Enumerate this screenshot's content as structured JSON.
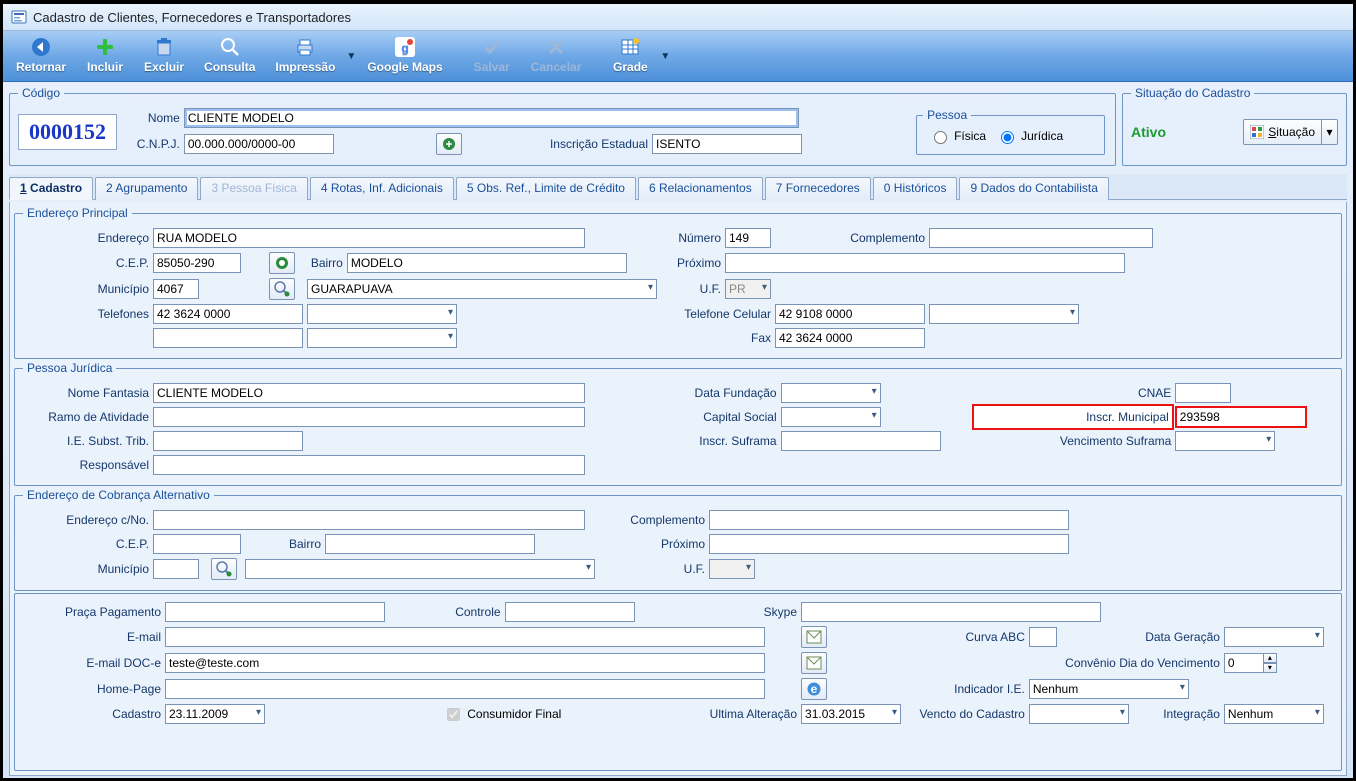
{
  "window": {
    "title": "Cadastro de Clientes, Fornecedores e Transportadores"
  },
  "toolbar": {
    "retornar": "Retornar",
    "incluir": "Incluir",
    "excluir": "Excluir",
    "consulta": "Consulta",
    "impressao": "Impressão",
    "googlemaps": "Google Maps",
    "salvar": "Salvar",
    "cancelar": "Cancelar",
    "grade": "Grade"
  },
  "header": {
    "codigo_legend": "Código",
    "codigo": "0000152",
    "nome_label": "Nome",
    "nome": "CLIENTE MODELO",
    "cnpj_label": "C.N.P.J.",
    "cnpj": "00.000.000/0000-00",
    "ie_label": "Inscrição Estadual",
    "ie": "ISENTO",
    "pessoa_legend": "Pessoa",
    "pessoa_fisica": "Física",
    "pessoa_juridica": "Jurídica",
    "situacao_legend": "Situação do Cadastro",
    "situacao_status": "Ativo",
    "situacao_btn": "Situação"
  },
  "tabs": {
    "t1": "1 Cadastro",
    "t2": "2 Agrupamento",
    "t3": "3 Pessoa Física",
    "t4": "4 Rotas, Inf. Adicionais",
    "t5": "5 Obs. Ref., Limite de Crédito",
    "t6": "6 Relacionamentos",
    "t7": "7 Fornecedores",
    "t8": "0 Históricos",
    "t9": "9 Dados do Contabilista"
  },
  "endereco_principal": {
    "legend": "Endereço Principal",
    "endereco_label": "Endereço",
    "endereco": "RUA MODELO",
    "numero_label": "Número",
    "numero": "149",
    "complemento_label": "Complemento",
    "complemento": "",
    "cep_label": "C.E.P.",
    "cep": "85050-290",
    "bairro_label": "Bairro",
    "bairro": "MODELO",
    "proximo_label": "Próximo",
    "proximo": "",
    "municipio_label": "Município",
    "municipio_cod": "4067",
    "municipio_nome": "GUARAPUAVA",
    "uf_label": "U.F.",
    "uf": "PR",
    "telefones_label": "Telefones",
    "telefone1": "42 3624 0000",
    "telefone_cel_label": "Telefone Celular",
    "telefone_cel": "42 9108 0000",
    "fax_label": "Fax",
    "fax": "42 3624 0000"
  },
  "pessoa_juridica": {
    "legend": "Pessoa Jurídica",
    "nome_fantasia_label": "Nome Fantasia",
    "nome_fantasia": "CLIENTE MODELO",
    "data_fundacao_label": "Data Fundação",
    "data_fundacao": "",
    "cnae_label": "CNAE",
    "cnae": "",
    "ramo_label": "Ramo de Atividade",
    "ramo": "",
    "capital_label": "Capital Social",
    "capital": "",
    "inscr_mun_label": "Inscr. Municipal",
    "inscr_mun": "293598",
    "ie_subst_label": "I.E. Subst. Trib.",
    "ie_subst": "",
    "inscr_suframa_label": "Inscr. Suframa",
    "inscr_suframa": "",
    "venc_suframa_label": "Vencimento Suframa",
    "venc_suframa": "",
    "responsavel_label": "Responsável",
    "responsavel": ""
  },
  "endereco_cobranca": {
    "legend": "Endereço de Cobrança Alternativo",
    "endereco_label": "Endereço c/No.",
    "endereco": "",
    "complemento_label": "Complemento",
    "complemento": "",
    "cep_label": "C.E.P.",
    "cep": "",
    "bairro_label": "Bairro",
    "bairro": "",
    "proximo_label": "Próximo",
    "proximo": "",
    "municipio_label": "Município",
    "municipio_cod": "",
    "municipio_nome": "",
    "uf_label": "U.F.",
    "uf": ""
  },
  "rodape": {
    "praca_label": "Praça Pagamento",
    "praca": "",
    "controle_label": "Controle",
    "controle": "",
    "skype_label": "Skype",
    "skype": "",
    "email_label": "E-mail",
    "email": "",
    "curva_label": "Curva ABC",
    "curva": "",
    "datager_label": "Data Geração",
    "datager": "",
    "emaildoce_label": "E-mail DOC-e",
    "emaildoce": "teste@teste.com",
    "convdia_label": "Convênio Dia do Vencimento",
    "convdia": "0",
    "homepage_label": "Home-Page",
    "homepage": "",
    "indicador_label": "Indicador I.E.",
    "indicador": "Nenhum",
    "cadastro_label": "Cadastro",
    "cadastro": "23.11.2009",
    "consfinal_label": "Consumidor Final",
    "ultalt_label": "Ultima Alteração",
    "ultalt": "31.03.2015",
    "vencto_label": "Vencto do Cadastro",
    "vencto": "",
    "integ_label": "Integração",
    "integ": "Nenhum"
  }
}
